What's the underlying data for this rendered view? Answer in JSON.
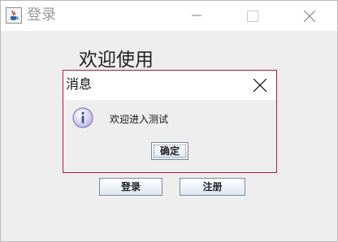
{
  "window": {
    "title": "登录",
    "icon": "java-cup-icon"
  },
  "main": {
    "welcome_text": "欢迎使用",
    "login_label": "登录",
    "register_label": "注册"
  },
  "dialog": {
    "title": "消息",
    "icon": "info-icon",
    "message": "欢迎进入测试",
    "ok_label": "确定",
    "border_color": "#b4164a"
  }
}
